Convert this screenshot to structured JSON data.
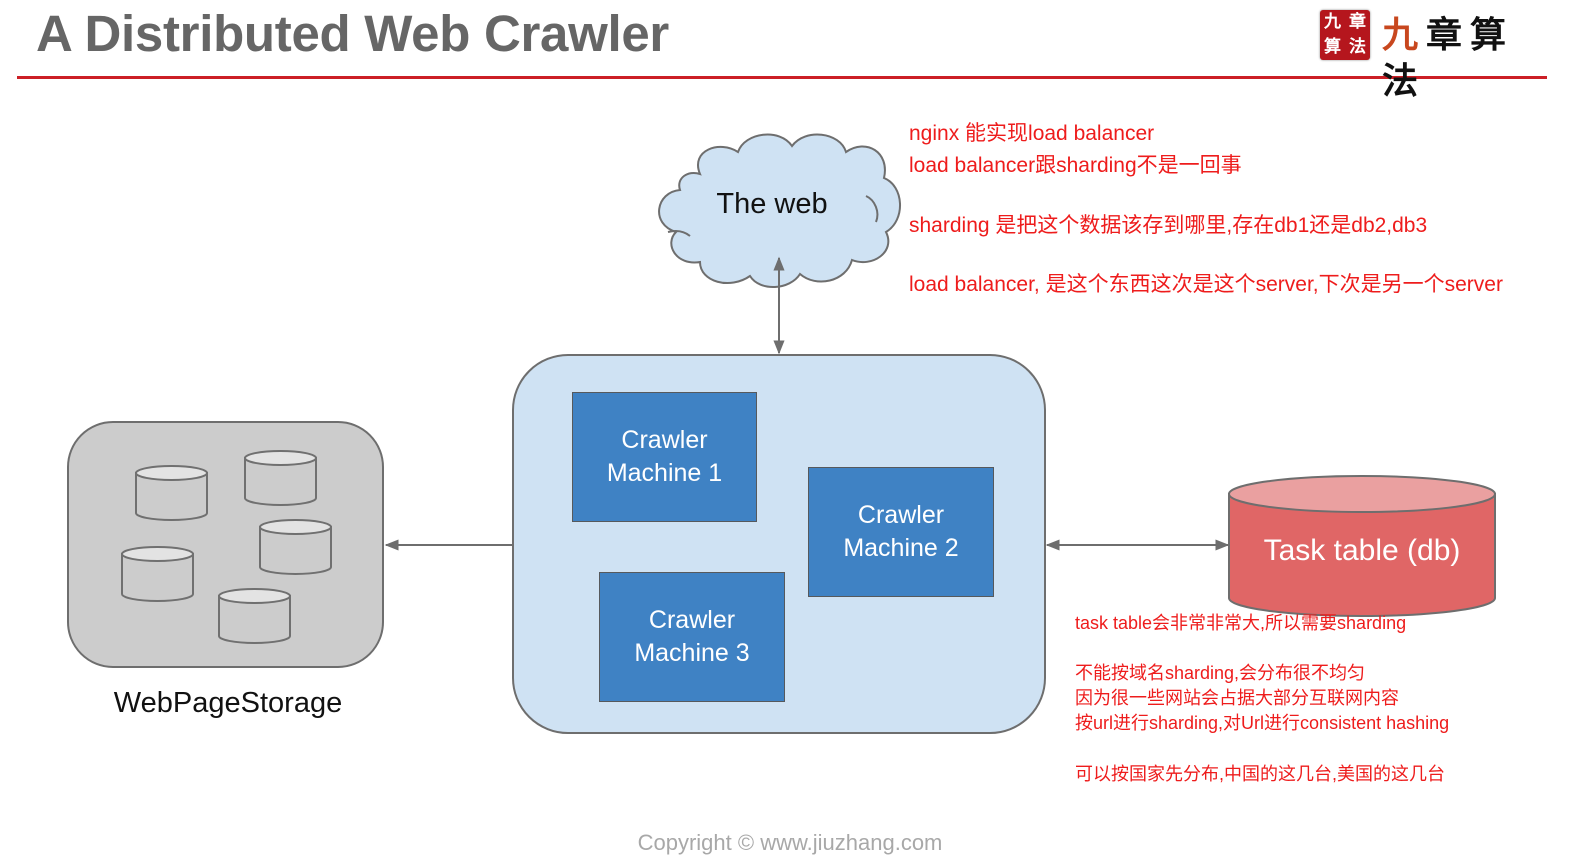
{
  "slide": {
    "title": "A Distributed Web Crawler",
    "accent_color": "#cc1f26",
    "logo": {
      "seal_chars": [
        "九",
        "章",
        "算",
        "法"
      ],
      "text_chars": [
        "九",
        "章",
        "算",
        "法"
      ]
    },
    "copyright": "Copyright © www.jiuzhang.com"
  },
  "diagram": {
    "cloud": {
      "label": "The web",
      "fill": "#cfe2f3"
    },
    "crawler_cluster": {
      "fill": "#cfe2f3",
      "machines": [
        {
          "line1": "Crawler",
          "line2": "Machine 1"
        },
        {
          "line1": "Crawler",
          "line2": "Machine 2"
        },
        {
          "line1": "Crawler",
          "line2": "Machine 3"
        }
      ],
      "machine_fill": "#3f82c4"
    },
    "storage": {
      "label": "WebPageStorage",
      "fill": "#cccccc",
      "disk_count": 5
    },
    "task_table": {
      "label": "Task table (db)",
      "fill": "#e06666",
      "top_fill": "#eaa0a0"
    },
    "connections": [
      {
        "from": "The web",
        "to": "Crawler cluster",
        "direction": "bidirectional"
      },
      {
        "from": "Crawler cluster",
        "to": "WebPageStorage",
        "direction": "one-way"
      },
      {
        "from": "Crawler cluster",
        "to": "Task table (db)",
        "direction": "bidirectional"
      }
    ]
  },
  "annotations": {
    "color": "#ee1c1c",
    "top_notes": [
      "nginx 能实现load balancer",
      "load balancer跟sharding不是一回事",
      "sharding 是把这个数据该存到哪里,存在db1还是db2,db3",
      "load balancer, 是这个东西这次是这个server,下次是另一个server"
    ],
    "bottom_notes": [
      "task table会非常非常大,所以需要sharding",
      "不能按域名sharding,会分布很不均匀",
      "因为很一些网站会占据大部分互联网内容",
      "按url进行sharding,对Url进行consistent hashing",
      "可以按国家先分布,中国的这几台,美国的这几台"
    ]
  }
}
